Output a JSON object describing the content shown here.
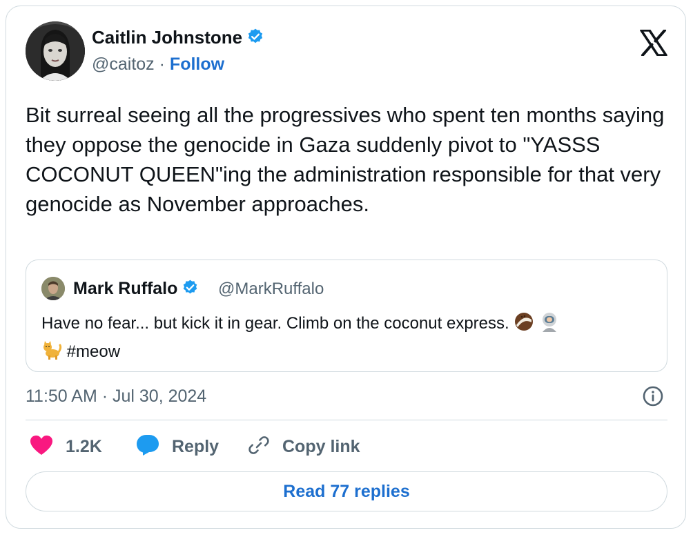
{
  "tweet": {
    "author_name": "Caitlin Johnstone",
    "handle": "@caitoz",
    "separator": "·",
    "follow_label": "Follow",
    "text": "Bit surreal seeing all the progressives who spent ten months saying they oppose the genocide in Gaza suddenly pivot to \"YASSS COCONUT QUEEN\"ing the administration responsible for that very genocide as November approaches.",
    "timestamp": "11:50 AM · Jul 30, 2024"
  },
  "quoted_tweet": {
    "author_name": "Mark Ruffalo",
    "handle": "@MarkRuffalo",
    "text_part1": "Have no fear... but kick it in gear. Climb on the coconut express.",
    "text_part2": "#meow",
    "emojis": [
      "coconut",
      "astronaut",
      "cat"
    ]
  },
  "actions": {
    "like_count": "1.2K",
    "reply_label": "Reply",
    "copy_link_label": "Copy link"
  },
  "read_replies_label": "Read 77 replies",
  "colors": {
    "accent": "#1d6fcf",
    "verified": "#1d9bf0",
    "like": "#f91880",
    "muted_text": "#536471",
    "border": "#cfd9de"
  },
  "icons": [
    "verified-badge-icon",
    "x-logo-icon",
    "info-icon",
    "heart-icon",
    "reply-bubble-icon",
    "link-icon"
  ]
}
